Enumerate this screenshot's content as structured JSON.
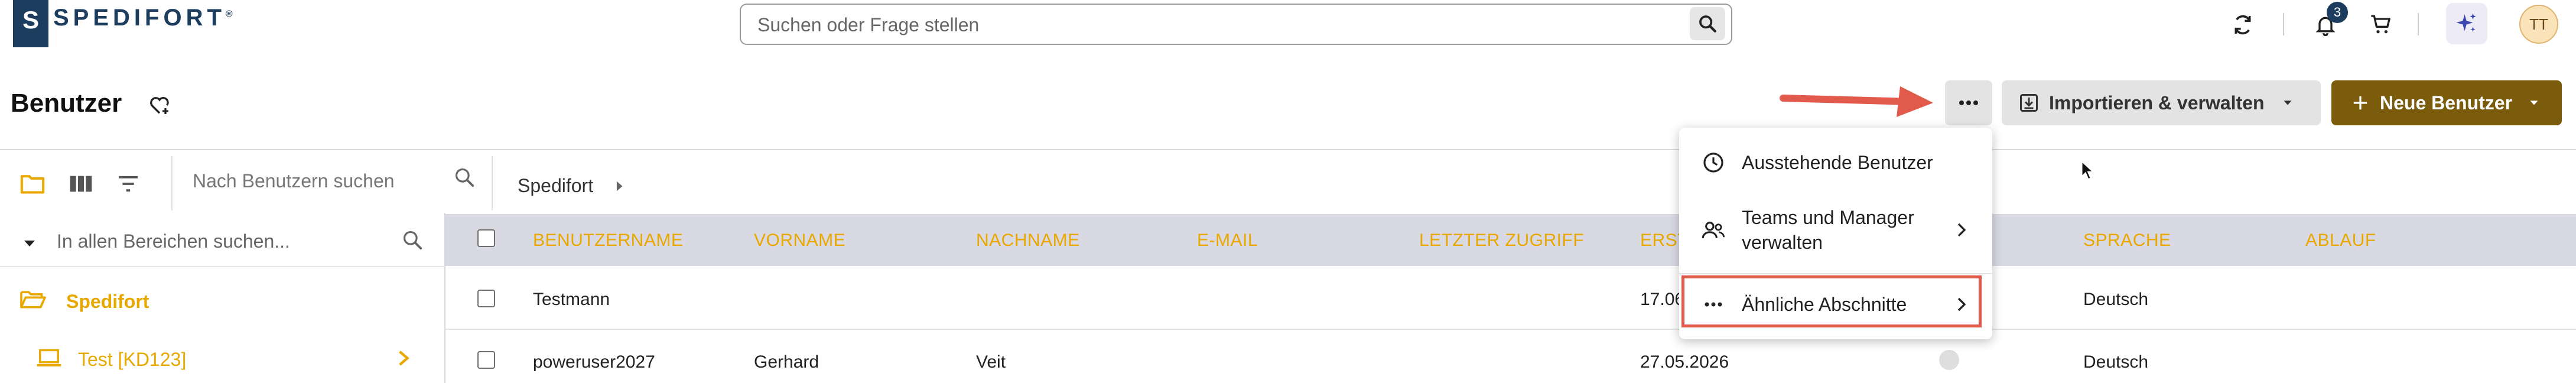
{
  "header": {
    "logo_text": "SPEDIFORT",
    "logo_reg": "®",
    "search_placeholder": "Suchen oder Frage stellen",
    "notification_count": "3",
    "avatar_initials": "TT"
  },
  "page": {
    "title": "Benutzer",
    "import_label": "Importieren & verwalten",
    "new_label": "Neue Benutzer"
  },
  "toolbar": {
    "user_search_placeholder": "Nach Benutzern suchen",
    "breadcrumb": "Spedifort"
  },
  "tree": {
    "search_placeholder": "In allen Bereichen suchen...",
    "root_label": "Spedifort",
    "child_label": "Test [KD123]"
  },
  "table": {
    "columns": [
      "BENUTZERNAME",
      "VORNAME",
      "NACHNAME",
      "E-MAIL",
      "LETZTER ZUGRIFF",
      "ERST",
      "SPRACHE",
      "ABLAUF"
    ],
    "rows": [
      {
        "username": "Testmann",
        "firstname": "",
        "lastname": "",
        "email": "",
        "last_access": "",
        "created": "17.06",
        "language": "Deutsch"
      },
      {
        "username": "poweruser2027",
        "firstname": "Gerhard",
        "lastname": "Veit",
        "email": "",
        "last_access": "",
        "created": "27.05.2026",
        "language": "Deutsch"
      }
    ]
  },
  "menu": {
    "items": [
      {
        "label": "Ausstehende Benutzer"
      },
      {
        "label_line1": "Teams und Manager",
        "label_line2": "verwalten"
      },
      {
        "label": "Ähnliche Abschnitte"
      }
    ]
  },
  "colors": {
    "brand_navy": "#1c3d5e",
    "accent_gold": "#e8a800",
    "primary_button": "#7a5c0c",
    "annotation_red": "#e25a4c"
  }
}
